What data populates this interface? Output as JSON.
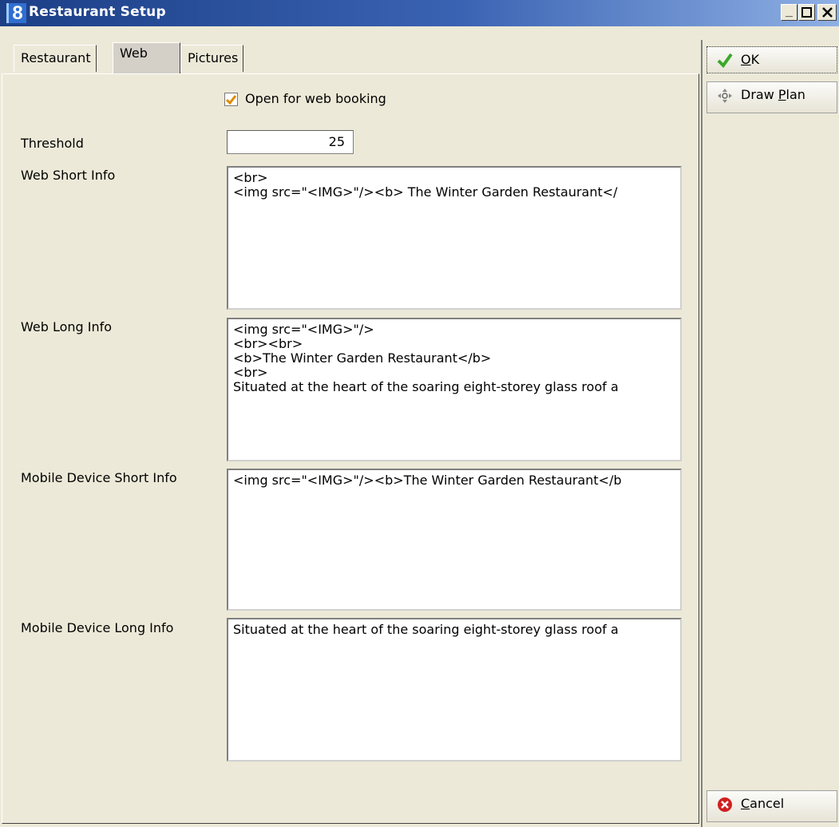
{
  "window": {
    "title": "Restaurant Setup",
    "icon_glyph": "8",
    "controls": [
      "minimize-icon",
      "maximize-icon",
      "close-icon"
    ]
  },
  "tabs": [
    {
      "label": "Restaurant",
      "active": false
    },
    {
      "label": "Web",
      "active": true
    },
    {
      "label": "Pictures",
      "active": false
    }
  ],
  "form": {
    "web_booking": {
      "label": "Open for web booking",
      "checked": true
    },
    "threshold": {
      "label": "Threshold",
      "value": "25"
    },
    "web_short_info": {
      "label": "Web Short Info",
      "value": "<br>\n<img src=\"<IMG>\"/><b> The Winter Garden Restaurant</"
    },
    "web_long_info": {
      "label": "Web Long Info",
      "value": "<img src=\"<IMG>\"/>\n<br><br>\n<b>The Winter Garden Restaurant</b>\n<br>\nSituated at the heart of the soaring eight-storey glass roof a"
    },
    "mobile_short_info": {
      "label": "Mobile Device Short Info",
      "value": "<img src=\"<IMG>\"/><b>The Winter Garden Restaurant</b"
    },
    "mobile_long_info": {
      "label": "Mobile Device Long Info",
      "value": "Situated at the heart of the soaring eight-storey glass roof a"
    }
  },
  "buttons": {
    "ok": {
      "pre": "",
      "key": "O",
      "post": "K",
      "icon": "checkmark-icon"
    },
    "draw_plan": {
      "pre": "Draw ",
      "key": "P",
      "post": "lan",
      "icon": "move-arrows-icon"
    },
    "cancel": {
      "pre": "",
      "key": "C",
      "post": "ancel",
      "icon": "cancel-icon"
    }
  },
  "colors": {
    "title_gradient_start": "#1c3f86",
    "title_gradient_end": "#8fb0e4",
    "check_accent": "#e08a00",
    "ok_check": "#3aa82a",
    "cancel_red": "#d02020"
  }
}
